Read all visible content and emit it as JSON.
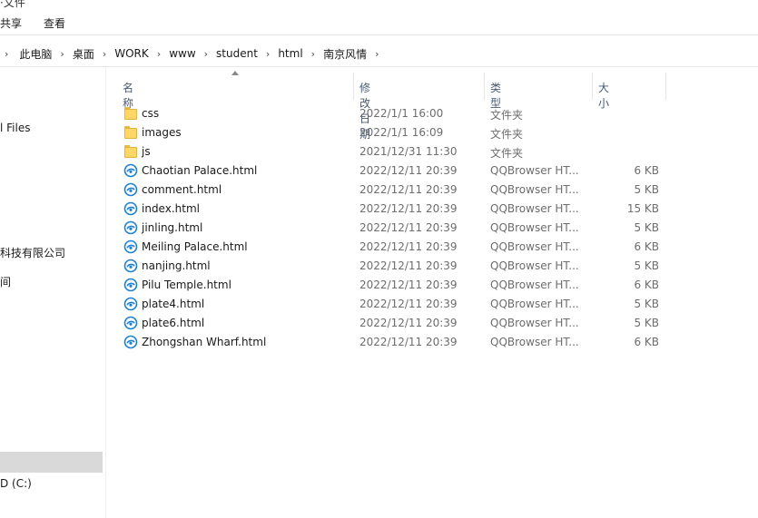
{
  "ribbon": {
    "top_cut": "·文件",
    "tabs": [
      "共享",
      "查看"
    ]
  },
  "address": {
    "crumbs": [
      "此电脑",
      "桌面",
      "WORK",
      "www",
      "student",
      "html",
      "南京风情"
    ]
  },
  "nav": {
    "items": [
      {
        "label": "l Files"
      },
      {
        "label": "科技有限公司"
      },
      {
        "label": "间"
      },
      {
        "label": ""
      },
      {
        "label": "D (C:)"
      }
    ]
  },
  "columns": {
    "name": "名称",
    "date": "修改日期",
    "type": "类型",
    "size": "大小"
  },
  "files": [
    {
      "icon": "folder-icon",
      "name": "css",
      "date": "2022/1/1 16:00",
      "type": "文件夹",
      "size": ""
    },
    {
      "icon": "folder-icon",
      "name": "images",
      "date": "2022/1/1 16:09",
      "type": "文件夹",
      "size": ""
    },
    {
      "icon": "folder-icon",
      "name": "js",
      "date": "2021/12/31 11:30",
      "type": "文件夹",
      "size": ""
    },
    {
      "icon": "html-file-icon",
      "name": "Chaotian Palace.html",
      "date": "2022/12/11 20:39",
      "type": "QQBrowser HT...",
      "size": "6 KB"
    },
    {
      "icon": "html-file-icon",
      "name": "comment.html",
      "date": "2022/12/11 20:39",
      "type": "QQBrowser HT...",
      "size": "5 KB"
    },
    {
      "icon": "html-file-icon",
      "name": "index.html",
      "date": "2022/12/11 20:39",
      "type": "QQBrowser HT...",
      "size": "15 KB"
    },
    {
      "icon": "html-file-icon",
      "name": "jinling.html",
      "date": "2022/12/11 20:39",
      "type": "QQBrowser HT...",
      "size": "5 KB"
    },
    {
      "icon": "html-file-icon",
      "name": "Meiling Palace.html",
      "date": "2022/12/11 20:39",
      "type": "QQBrowser HT...",
      "size": "6 KB"
    },
    {
      "icon": "html-file-icon",
      "name": "nanjing.html",
      "date": "2022/12/11 20:39",
      "type": "QQBrowser HT...",
      "size": "5 KB"
    },
    {
      "icon": "html-file-icon",
      "name": "Pilu Temple.html",
      "date": "2022/12/11 20:39",
      "type": "QQBrowser HT...",
      "size": "6 KB"
    },
    {
      "icon": "html-file-icon",
      "name": "plate4.html",
      "date": "2022/12/11 20:39",
      "type": "QQBrowser HT...",
      "size": "5 KB"
    },
    {
      "icon": "html-file-icon",
      "name": "plate6.html",
      "date": "2022/12/11 20:39",
      "type": "QQBrowser HT...",
      "size": "5 KB"
    },
    {
      "icon": "html-file-icon",
      "name": "Zhongshan Wharf.html",
      "date": "2022/12/11 20:39",
      "type": "QQBrowser HT...",
      "size": "6 KB"
    }
  ],
  "colors": {
    "folder": "#ffd766",
    "html_icon": "#1e7fd6",
    "nav_selected": "#d9d9d9"
  }
}
